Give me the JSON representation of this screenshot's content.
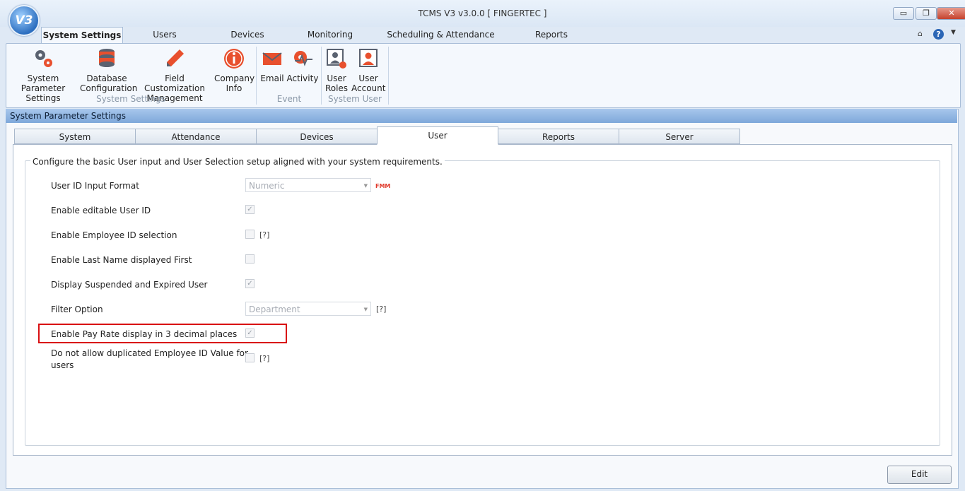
{
  "window": {
    "title": "TCMS V3 v3.0.0 [ FINGERTEC ]",
    "logo_text": "V3"
  },
  "menu": {
    "tabs": [
      {
        "label": "System Settings"
      },
      {
        "label": "Users"
      },
      {
        "label": "Devices"
      },
      {
        "label": "Monitoring"
      },
      {
        "label": "Scheduling & Attendance"
      },
      {
        "label": "Reports"
      }
    ],
    "help_label": "?"
  },
  "ribbon": {
    "buttons": [
      {
        "line1": "System Parameter",
        "line2": "Settings",
        "icon": "gears-icon"
      },
      {
        "line1": "Database",
        "line2": "Configuration",
        "icon": "database-icon"
      },
      {
        "line1": "Field Customization",
        "line2": "Management",
        "icon": "pencil-icon"
      },
      {
        "line1": "Company",
        "line2": "Info",
        "icon": "info-icon"
      },
      {
        "line1": "Email",
        "line2": "",
        "icon": "envelope-icon"
      },
      {
        "line1": "Activity",
        "line2": "",
        "icon": "activity-gear-icon"
      },
      {
        "line1": "User",
        "line2": "Roles",
        "icon": "user-roles-icon"
      },
      {
        "line1": "User",
        "line2": "Account",
        "icon": "user-account-icon"
      }
    ],
    "groups": [
      {
        "label": "System Settings"
      },
      {
        "label": "Event"
      },
      {
        "label": "System User"
      }
    ]
  },
  "panel": {
    "title": "System Parameter Settings",
    "tabs": [
      {
        "label": "System"
      },
      {
        "label": "Attendance"
      },
      {
        "label": "Devices"
      },
      {
        "label": "User"
      },
      {
        "label": "Reports"
      },
      {
        "label": "Server"
      }
    ],
    "active_tab": "User",
    "group_caption": "Configure the basic User input and User Selection setup aligned with your system requirements.",
    "fields": {
      "user_id_format": {
        "label": "User ID Input Format",
        "value": "Numeric",
        "badge": "FMM"
      },
      "editable_user_id": {
        "label": "Enable editable User ID",
        "checked": true
      },
      "employee_id_selection": {
        "label": "Enable Employee ID selection",
        "checked": false,
        "help": "[?]"
      },
      "last_name_first": {
        "label": "Enable Last Name displayed First",
        "checked": false
      },
      "suspended_expired": {
        "label": "Display Suspended and Expired User",
        "checked": true
      },
      "filter_option": {
        "label": "Filter Option",
        "value": "Department",
        "help": "[?]"
      },
      "pay_rate_decimals": {
        "label": "Enable Pay Rate display in 3 decimal places",
        "checked": true
      },
      "no_duplicate_employee_id": {
        "label_line1": "Do not allow duplicated Employee ID Value for",
        "label_line2": "users",
        "checked": false,
        "help": "[?]"
      }
    },
    "edit_button": "Edit"
  },
  "colors": {
    "accent": "#2b66b6",
    "highlight_border": "#d90f12",
    "header_bg": "#7ea8da"
  }
}
